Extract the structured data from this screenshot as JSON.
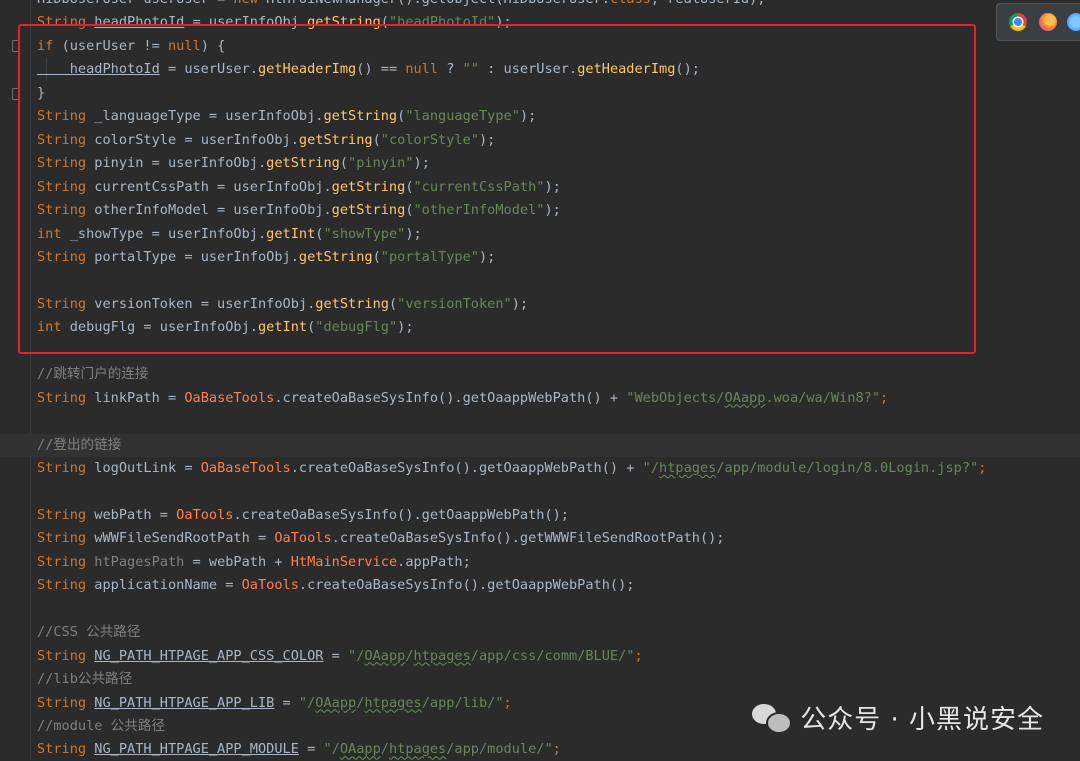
{
  "code_lines": [
    [
      [
        "HiDbUserUser userUser = ",
        "t-plain"
      ],
      [
        "new ",
        "t-kw"
      ],
      [
        "HtHrUiNewManager",
        "t-plain"
      ],
      [
        "().getObject(",
        "t-plain"
      ],
      [
        "HiDbUserUser",
        "t-plain"
      ],
      [
        ".",
        "t-plain"
      ],
      [
        "class",
        "t-kw"
      ],
      [
        ", realUserId);",
        "t-plain"
      ]
    ],
    [
      [
        "String ",
        "t-kw"
      ],
      [
        "headPhotoId",
        "t-plain u"
      ],
      [
        " = userInfoObj.",
        "t-plain"
      ],
      [
        "getString",
        "t-fn"
      ],
      [
        "(",
        "t-plain"
      ],
      [
        "\"headPhotoId\"",
        "t-str"
      ],
      [
        ");",
        "t-plain"
      ]
    ],
    [
      [
        "if ",
        "t-kw"
      ],
      [
        "(userUser != ",
        "t-plain"
      ],
      [
        "null",
        "t-kw"
      ],
      [
        ") {",
        "t-plain"
      ]
    ],
    [
      [
        "    headPhotoId",
        "t-plain u"
      ],
      [
        " = userUser.",
        "t-plain"
      ],
      [
        "getHeaderImg",
        "t-fn"
      ],
      [
        "() == ",
        "t-plain"
      ],
      [
        "null ",
        "t-kw"
      ],
      [
        "? ",
        "t-plain"
      ],
      [
        "\"\" ",
        "t-str"
      ],
      [
        ": userUser.",
        "t-plain"
      ],
      [
        "getHeaderImg",
        "t-fn"
      ],
      [
        "();",
        "t-plain"
      ]
    ],
    [
      [
        "}",
        "t-plain"
      ]
    ],
    [
      [
        "String ",
        "t-kw"
      ],
      [
        "_languageType = userInfoObj.",
        "t-plain"
      ],
      [
        "getString",
        "t-fn"
      ],
      [
        "(",
        "t-plain"
      ],
      [
        "\"languageType\"",
        "t-str"
      ],
      [
        ");",
        "t-plain"
      ]
    ],
    [
      [
        "String ",
        "t-kw"
      ],
      [
        "colorStyle = userInfoObj.",
        "t-plain"
      ],
      [
        "getString",
        "t-fn"
      ],
      [
        "(",
        "t-plain"
      ],
      [
        "\"colorStyle\"",
        "t-str"
      ],
      [
        ");",
        "t-plain"
      ]
    ],
    [
      [
        "String ",
        "t-kw"
      ],
      [
        "pinyin = userInfoObj.",
        "t-plain"
      ],
      [
        "getString",
        "t-fn"
      ],
      [
        "(",
        "t-plain"
      ],
      [
        "\"pinyin\"",
        "t-str"
      ],
      [
        ");",
        "t-plain"
      ]
    ],
    [
      [
        "String ",
        "t-kw"
      ],
      [
        "currentCssPath = userInfoObj.",
        "t-plain"
      ],
      [
        "getString",
        "t-fn"
      ],
      [
        "(",
        "t-plain"
      ],
      [
        "\"currentCssPath\"",
        "t-str"
      ],
      [
        ");",
        "t-plain"
      ]
    ],
    [
      [
        "String ",
        "t-kw"
      ],
      [
        "otherInfoModel = userInfoObj.",
        "t-plain"
      ],
      [
        "getString",
        "t-fn"
      ],
      [
        "(",
        "t-plain"
      ],
      [
        "\"otherInfoModel\"",
        "t-str"
      ],
      [
        ");",
        "t-plain"
      ]
    ],
    [
      [
        "int ",
        "t-kw"
      ],
      [
        "_showType = userInfoObj.",
        "t-plain"
      ],
      [
        "getInt",
        "t-fn"
      ],
      [
        "(",
        "t-plain"
      ],
      [
        "\"showType\"",
        "t-str"
      ],
      [
        ");",
        "t-plain"
      ]
    ],
    [
      [
        "String ",
        "t-kw"
      ],
      [
        "portalType = userInfoObj.",
        "t-plain"
      ],
      [
        "getString",
        "t-fn"
      ],
      [
        "(",
        "t-plain"
      ],
      [
        "\"portalType\"",
        "t-str"
      ],
      [
        ");",
        "t-plain"
      ]
    ],
    [],
    [
      [
        "String ",
        "t-kw"
      ],
      [
        "versionToken = userInfoObj.",
        "t-plain"
      ],
      [
        "getString",
        "t-fn"
      ],
      [
        "(",
        "t-plain"
      ],
      [
        "\"versionToken\"",
        "t-str"
      ],
      [
        ");",
        "t-plain"
      ]
    ],
    [
      [
        "int ",
        "t-kw"
      ],
      [
        "debugFlg = userInfoObj.",
        "t-plain"
      ],
      [
        "getInt",
        "t-fn"
      ],
      [
        "(",
        "t-plain"
      ],
      [
        "\"debugFlg\"",
        "t-str"
      ],
      [
        ");",
        "t-plain"
      ]
    ],
    [],
    [
      [
        "//跳转门户的连接",
        "t-cm"
      ]
    ],
    [
      [
        "String ",
        "t-kw"
      ],
      [
        "linkPath = ",
        "t-plain"
      ],
      [
        "OaBaseTools",
        "t-cls"
      ],
      [
        ".createOaBaseSysInfo().getOaappWebPath() + ",
        "t-plain"
      ],
      [
        "\"WebObjects/",
        "t-str"
      ],
      [
        "OAapp",
        "t-str w"
      ],
      [
        ".woa/wa/Win8?\"",
        "t-str"
      ],
      [
        ";",
        "t-kw"
      ]
    ],
    [],
    [
      [
        "//登出的链接",
        "t-cm"
      ]
    ],
    [
      [
        "String ",
        "t-kw"
      ],
      [
        "logOutLink = ",
        "t-plain"
      ],
      [
        "OaBaseTools",
        "t-cls"
      ],
      [
        ".createOaBaseSysInfo().getOaappWebPath() + ",
        "t-plain"
      ],
      [
        "\"/",
        "t-str"
      ],
      [
        "htpages",
        "t-str w"
      ],
      [
        "/app/module/login/8.0Login.jsp?\"",
        "t-str"
      ],
      [
        ";",
        "t-kw"
      ]
    ],
    [],
    [
      [
        "String ",
        "t-kw"
      ],
      [
        "webPath = ",
        "t-plain"
      ],
      [
        "OaTools",
        "t-cls"
      ],
      [
        ".createOaBaseSysInfo().getOaappWebPath();",
        "t-plain"
      ]
    ],
    [
      [
        "String ",
        "t-kw"
      ],
      [
        "wWWFileSendRootPath = ",
        "t-plain"
      ],
      [
        "OaTools",
        "t-cls"
      ],
      [
        ".createOaBaseSysInfo().getWWWFileSendRootPath();",
        "t-plain"
      ]
    ],
    [
      [
        "String ",
        "t-kw"
      ],
      [
        "htPagesPath",
        "t-cm"
      ],
      [
        " = webPath + ",
        "t-plain"
      ],
      [
        "HtMainService",
        "t-cls"
      ],
      [
        ".appPath;",
        "t-plain"
      ]
    ],
    [
      [
        "String ",
        "t-kw"
      ],
      [
        "applicationName = ",
        "t-plain"
      ],
      [
        "OaTools",
        "t-cls"
      ],
      [
        ".createOaBaseSysInfo().getOaappWebPath();",
        "t-plain"
      ]
    ],
    [],
    [
      [
        "//CSS 公共路径",
        "t-cm"
      ]
    ],
    [
      [
        "String ",
        "t-kw"
      ],
      [
        "NG_PATH_HTPAGE_APP_CSS_COLOR",
        "t-plain u"
      ],
      [
        " = ",
        "t-plain"
      ],
      [
        "\"/",
        "t-str"
      ],
      [
        "OAapp",
        "t-str w"
      ],
      [
        "/",
        "t-str"
      ],
      [
        "htpages",
        "t-str w"
      ],
      [
        "/app/css/comm/BLUE/\"",
        "t-str"
      ],
      [
        ";",
        "t-kw"
      ]
    ],
    [
      [
        "//lib公共路径",
        "t-cm"
      ]
    ],
    [
      [
        "String ",
        "t-kw"
      ],
      [
        "NG_PATH_HTPAGE_APP_LIB",
        "t-plain u"
      ],
      [
        " = ",
        "t-plain"
      ],
      [
        "\"/",
        "t-str"
      ],
      [
        "OAapp",
        "t-str w"
      ],
      [
        "/",
        "t-str"
      ],
      [
        "htpages",
        "t-str w"
      ],
      [
        "/app/lib/\"",
        "t-str"
      ],
      [
        ";",
        "t-kw"
      ]
    ],
    [
      [
        "//module 公共路径",
        "t-cm"
      ]
    ],
    [
      [
        "String ",
        "t-kw"
      ],
      [
        "NG_PATH_HTPAGE_APP_MODULE",
        "t-plain u"
      ],
      [
        " = ",
        "t-plain"
      ],
      [
        "\"/",
        "t-str"
      ],
      [
        "OAapp",
        "t-str w"
      ],
      [
        "/",
        "t-str"
      ],
      [
        "htpages",
        "t-str w"
      ],
      [
        "/app/module/\"",
        "t-str"
      ],
      [
        ";",
        "t-kw"
      ]
    ]
  ],
  "highlighted_lines": [
    19
  ],
  "watermark": {
    "text": "公众号 · 小黑说安全"
  },
  "browser_icons": [
    "chrome-icon",
    "firefox-icon",
    "safari-icon"
  ],
  "colors": {
    "background": "#2b2b2b",
    "keyword": "#cc7832",
    "string": "#6a8759",
    "method": "#ffc66d",
    "class_ref": "#ff7f50",
    "comment": "#808080",
    "selection_border": "#e8202a"
  }
}
